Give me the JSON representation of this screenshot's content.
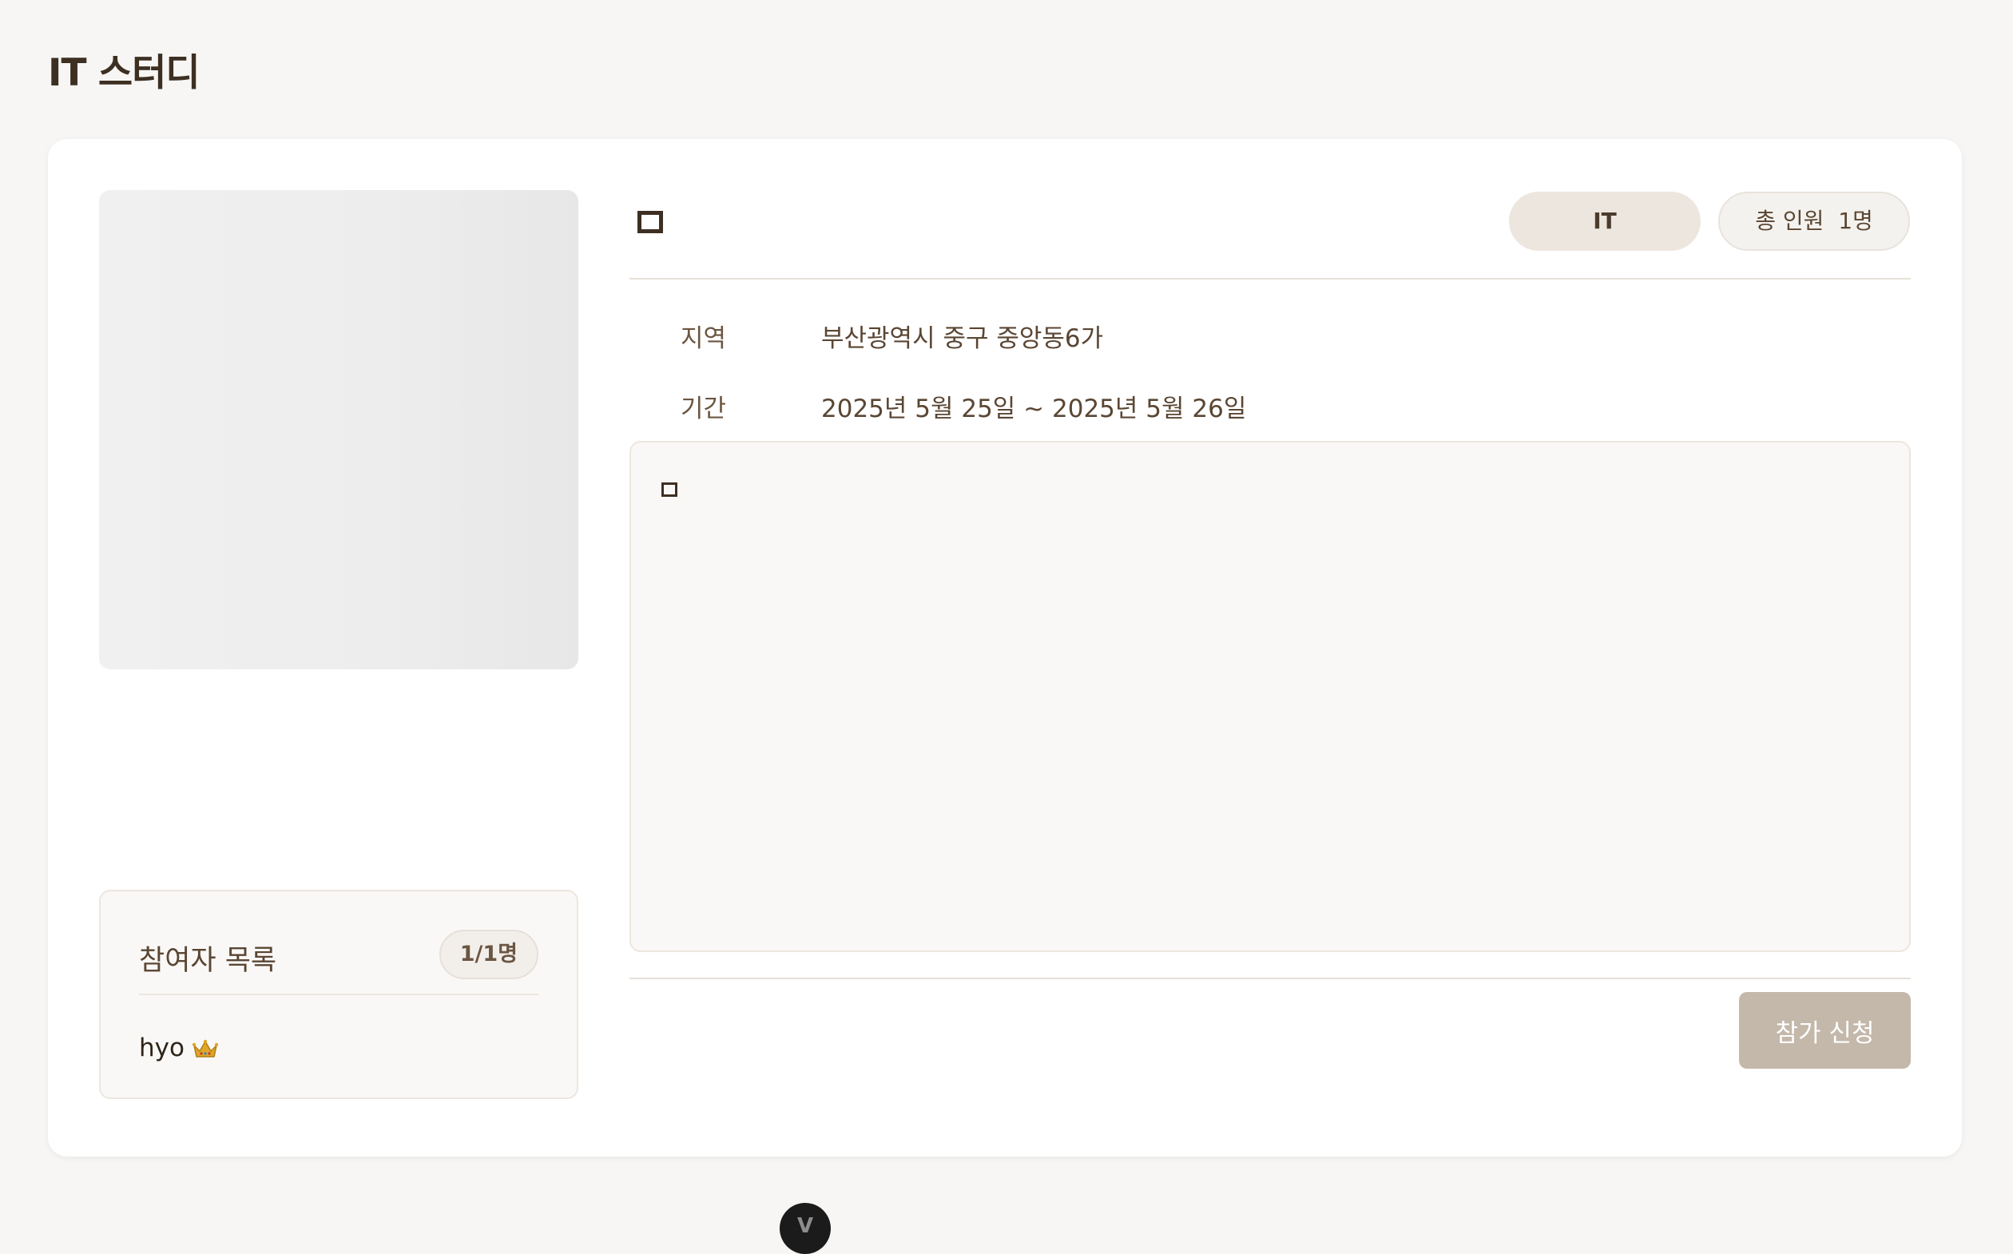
{
  "page": {
    "title": "IT 스터디"
  },
  "study": {
    "tags": {
      "category": "IT",
      "members": "총 인원  1명"
    },
    "info": {
      "region_label": "지역",
      "region_value": "부산광역시 중구 중앙동6가",
      "period_label": "기간",
      "period_value": "2025년 5월 25일 ~ 2025년 5월 26일"
    },
    "join_button": "참가 신청"
  },
  "participants": {
    "title": "참여자 목록",
    "count": "1/1명",
    "items": [
      {
        "name": "hyo",
        "role_icon": "crown-icon"
      }
    ]
  },
  "devtools": {
    "label": "V"
  },
  "colors": {
    "background": "#f7f6f4",
    "card": "#ffffff",
    "primary_text": "#3d2f22",
    "button": "#c4b8aa",
    "tag_category": "#ede6df"
  }
}
